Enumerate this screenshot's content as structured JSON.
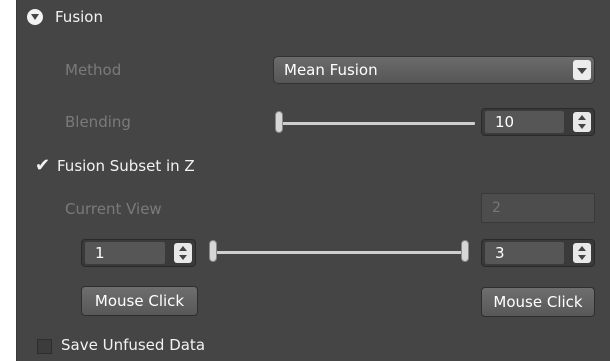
{
  "section": {
    "title": "Fusion",
    "icon": "chevron-down-circle-icon"
  },
  "method": {
    "label": "Method",
    "value": "Mean Fusion",
    "icon": "dropdown-arrow-icon"
  },
  "blending": {
    "label": "Blending",
    "value": "10",
    "slider_fraction": 0.0
  },
  "fusion_subset": {
    "label": "Fusion Subset in Z",
    "checked": true
  },
  "current_view": {
    "label": "Current View",
    "value": "2"
  },
  "range": {
    "start": "1",
    "end": "3",
    "start_fraction": 0.0,
    "end_fraction": 1.0
  },
  "buttons": {
    "mouse_click_left": "Mouse Click",
    "mouse_click_right": "Mouse Click"
  },
  "save_unfused": {
    "label": "Save Unfused Data",
    "checked": false
  },
  "colors": {
    "panel_bg": "#454545",
    "text": "#f2f2f2",
    "text_disabled": "#7a7a7a"
  }
}
